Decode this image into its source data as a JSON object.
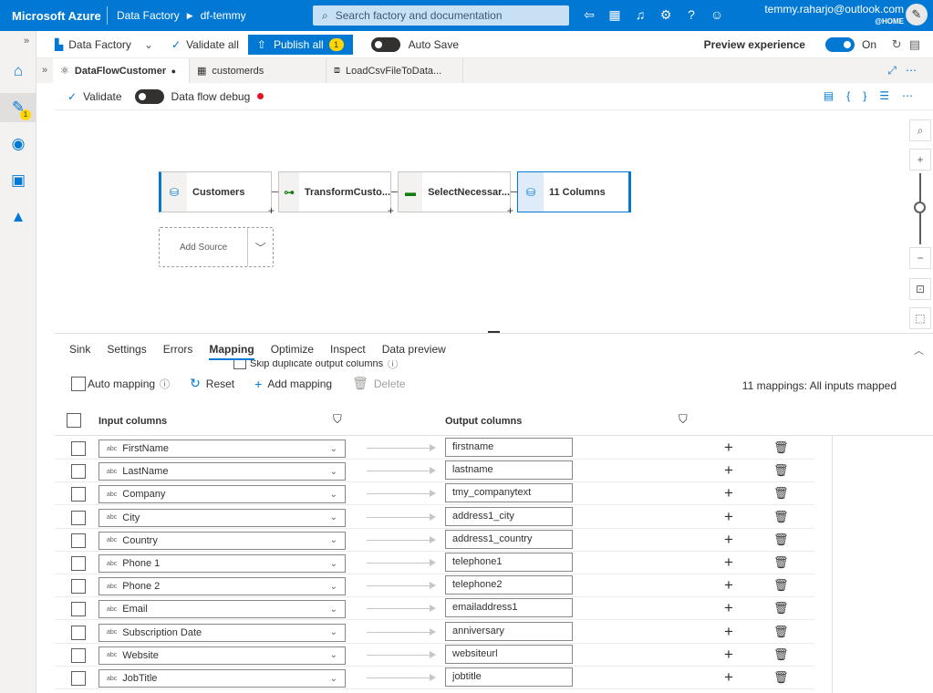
{
  "topbar": {
    "brand": "Microsoft Azure",
    "service": "Data Factory",
    "factory": "df-temmy",
    "search_placeholder": "Search factory and documentation",
    "user_email": "temmy.raharjo@outlook.com",
    "user_tenant": "@HOME",
    "icons": [
      "feedback-icon",
      "portal-icon",
      "bell-icon",
      "gear-icon",
      "help-icon",
      "person-feedback-icon"
    ]
  },
  "toolbar": {
    "data_factory_label": "Data Factory",
    "validate_all_label": "Validate all",
    "publish_all_label": "Publish all",
    "publish_count": "1",
    "auto_save_label": "Auto Save",
    "preview_label": "Preview experience",
    "preview_state": "On"
  },
  "rail": {
    "author_badge": "1"
  },
  "tabs": [
    {
      "label": "DataFlowCustomer",
      "icon": "dataflow-icon",
      "active": true
    },
    {
      "label": "customerds",
      "icon": "table-icon",
      "active": false
    },
    {
      "label": "LoadCsvFileToData...",
      "icon": "pipeline-icon",
      "active": false
    }
  ],
  "subtoolbar": {
    "validate_label": "Validate",
    "debug_label": "Data flow debug"
  },
  "flow": {
    "nodes": [
      "Customers",
      "TransformCusto...",
      "SelectNecessar...",
      "11 Columns"
    ],
    "add_source": "Add Source"
  },
  "panel": {
    "tabs": [
      "Sink",
      "Settings",
      "Errors",
      "Mapping",
      "Optimize",
      "Inspect",
      "Data preview"
    ],
    "active_tab": "Mapping",
    "skip_duplicate_label": "Skip duplicate output columns",
    "auto_mapping_label": "Auto mapping",
    "reset_label": "Reset",
    "add_mapping_label": "Add mapping",
    "delete_label": "Delete",
    "mapping_summary": "11 mappings: All inputs mapped",
    "input_header": "Input columns",
    "output_header": "Output columns",
    "type_label": "abc"
  },
  "mappings": [
    {
      "input": "FirstName",
      "output": "firstname"
    },
    {
      "input": "LastName",
      "output": "lastname"
    },
    {
      "input": "Company",
      "output": "tmy_companytext"
    },
    {
      "input": "City",
      "output": "address1_city"
    },
    {
      "input": "Country",
      "output": "address1_country"
    },
    {
      "input": "Phone 1",
      "output": "telephone1"
    },
    {
      "input": "Phone 2",
      "output": "telephone2"
    },
    {
      "input": "Email",
      "output": "emailaddress1"
    },
    {
      "input": "Subscription Date",
      "output": "anniversary"
    },
    {
      "input": "Website",
      "output": "websiteurl"
    },
    {
      "input": "JobTitle",
      "output": "jobtitle"
    }
  ]
}
